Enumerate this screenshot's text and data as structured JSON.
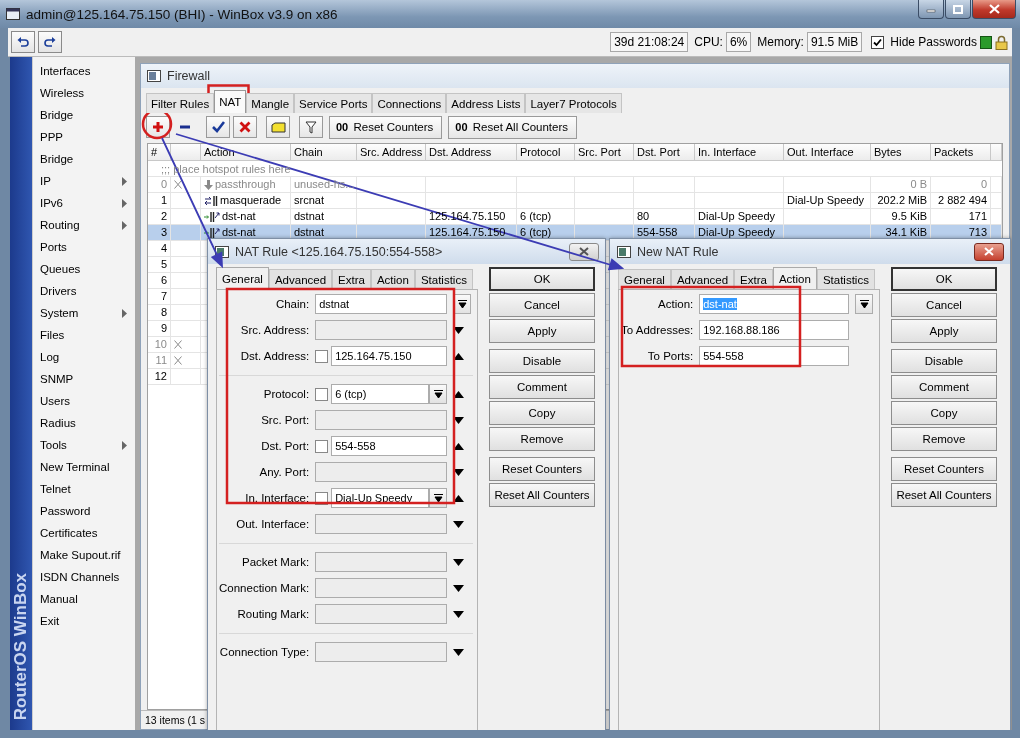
{
  "window": {
    "title": "admin@125.164.75.150 (BHI) - WinBox v3.9 on x86"
  },
  "topbar": {
    "uptime": "39d 21:08:24",
    "cpu_label": "CPU:",
    "cpu": "6%",
    "memory_label": "Memory:",
    "memory": "91.5 MiB",
    "hide_passwords": {
      "label": "Hide Passwords",
      "checked": true
    }
  },
  "side_banner": "RouterOS WinBox",
  "menu": [
    {
      "label": "Interfaces",
      "submenu": false
    },
    {
      "label": "Wireless",
      "submenu": false
    },
    {
      "label": "Bridge",
      "submenu": false
    },
    {
      "label": "PPP",
      "submenu": false
    },
    {
      "label": "Bridge",
      "submenu": false
    },
    {
      "label": "IP",
      "submenu": true
    },
    {
      "label": "IPv6",
      "submenu": true
    },
    {
      "label": "Routing",
      "submenu": true
    },
    {
      "label": "Ports",
      "submenu": false
    },
    {
      "label": "Queues",
      "submenu": false
    },
    {
      "label": "Drivers",
      "submenu": false
    },
    {
      "label": "System",
      "submenu": true
    },
    {
      "label": "Files",
      "submenu": false
    },
    {
      "label": "Log",
      "submenu": false
    },
    {
      "label": "SNMP",
      "submenu": false
    },
    {
      "label": "Users",
      "submenu": false
    },
    {
      "label": "Radius",
      "submenu": false
    },
    {
      "label": "Tools",
      "submenu": true
    },
    {
      "label": "New Terminal",
      "submenu": false
    },
    {
      "label": "Telnet",
      "submenu": false
    },
    {
      "label": "Password",
      "submenu": false
    },
    {
      "label": "Certificates",
      "submenu": false
    },
    {
      "label": "Make Supout.rif",
      "submenu": false
    },
    {
      "label": "ISDN Channels",
      "submenu": false
    },
    {
      "label": "Manual",
      "submenu": false
    },
    {
      "label": "Exit",
      "submenu": false
    }
  ],
  "firewall": {
    "title": "Firewall",
    "tabs": [
      {
        "label": "Filter Rules",
        "selected": false
      },
      {
        "label": "NAT",
        "selected": true
      },
      {
        "label": "Mangle",
        "selected": false
      },
      {
        "label": "Service Ports",
        "selected": false
      },
      {
        "label": "Connections",
        "selected": false
      },
      {
        "label": "Address Lists",
        "selected": false
      },
      {
        "label": "Layer7 Protocols",
        "selected": false
      }
    ],
    "toolbar": [
      {
        "kind": "add"
      },
      {
        "kind": "remove"
      },
      {
        "kind": "enable"
      },
      {
        "kind": "disable"
      },
      {
        "kind": "comment"
      },
      {
        "kind": "filter"
      },
      {
        "kind": "counter",
        "icon_text": "00",
        "label": "Reset Counters"
      },
      {
        "kind": "counter",
        "icon_text": "00",
        "label": "Reset All Counters"
      }
    ],
    "table": {
      "columns": [
        "#",
        "Action",
        "Chain",
        "Src. Address",
        "Dst. Address",
        "Protocol",
        "Src. Port",
        "Dst. Port",
        "In. Interface",
        "Out. Interface",
        "Bytes",
        "Packets"
      ],
      "rows": [
        {
          "kind": "comment",
          "text": ";;; place hotspot rules here"
        },
        {
          "kind": "passthrough",
          "num": "0",
          "disabled": true,
          "selected": false,
          "cells": {
            "action": "passthrough",
            "chain": "unused-hs...",
            "bytes": "0 B",
            "packets": "0"
          }
        },
        {
          "kind": "masquerade",
          "num": "1",
          "disabled": false,
          "selected": false,
          "cells": {
            "action": "masquerade",
            "chain": "srcnat",
            "out_interface": "Dial-Up Speedy",
            "bytes": "202.2 MiB",
            "packets": "2 882 494"
          }
        },
        {
          "kind": "dstnat",
          "num": "2",
          "disabled": false,
          "selected": false,
          "cells": {
            "action": "dst-nat",
            "chain": "dstnat",
            "dst_address": "125.164.75.150",
            "protocol": "6 (tcp)",
            "dst_port": "80",
            "in_interface": "Dial-Up Speedy",
            "bytes": "9.5 KiB",
            "packets": "171"
          }
        },
        {
          "kind": "dstnat",
          "num": "3",
          "disabled": false,
          "selected": true,
          "cells": {
            "action": "dst-nat",
            "chain": "dstnat",
            "dst_address": "125.164.75.150",
            "protocol": "6 (tcp)",
            "dst_port": "554-558",
            "in_interface": "Dial-Up Speedy",
            "bytes": "34.1 KiB",
            "packets": "713"
          }
        },
        {
          "kind": "rule",
          "num": "4",
          "disabled": false,
          "selected": false
        },
        {
          "kind": "rule",
          "num": "5",
          "disabled": false,
          "selected": false
        },
        {
          "kind": "rule",
          "num": "6",
          "disabled": false,
          "selected": false
        },
        {
          "kind": "rule",
          "num": "7",
          "disabled": false,
          "selected": false
        },
        {
          "kind": "rule",
          "num": "8",
          "disabled": false,
          "selected": false
        },
        {
          "kind": "rule",
          "num": "9",
          "disabled": false,
          "selected": false
        },
        {
          "kind": "rule",
          "num": "10",
          "disabled": true,
          "selected": false
        },
        {
          "kind": "rule",
          "num": "11",
          "disabled": true,
          "selected": false
        },
        {
          "kind": "rule",
          "num": "12",
          "disabled": false,
          "selected": false
        }
      ]
    },
    "status": "13 items (1 s"
  },
  "dialogs": [
    {
      "title": "NAT Rule <125.164.75.150:554-558>",
      "active": false,
      "tabs": [
        {
          "label": "General",
          "selected": true
        },
        {
          "label": "Advanced",
          "selected": false
        },
        {
          "label": "Extra",
          "selected": false
        },
        {
          "label": "Action",
          "selected": false
        },
        {
          "label": "Statistics",
          "selected": false
        }
      ],
      "groups": [
        [
          {
            "label": "Chain:",
            "kind": "combo",
            "value": "dstnat"
          },
          {
            "label": "Src. Address:",
            "kind": "text",
            "expanded": false
          },
          {
            "label": "Dst. Address:",
            "kind": "text",
            "negate": false,
            "value": "125.164.75.150",
            "expanded": true
          }
        ],
        [
          {
            "label": "Protocol:",
            "kind": "combo",
            "negate": false,
            "value": "6 (tcp)",
            "expanded": true
          },
          {
            "label": "Src. Port:",
            "kind": "text",
            "expanded": false
          },
          {
            "label": "Dst. Port:",
            "kind": "text",
            "negate": false,
            "value": "554-558",
            "expanded": true
          },
          {
            "label": "Any. Port:",
            "kind": "text",
            "expanded": false
          },
          {
            "label": "In. Interface:",
            "kind": "combo",
            "negate": false,
            "value": "Dial-Up Speedy",
            "expanded": true
          },
          {
            "label": "Out. Interface:",
            "kind": "text",
            "expanded": false
          }
        ],
        [
          {
            "label": "Packet Mark:",
            "kind": "text",
            "expanded": false
          },
          {
            "label": "Connection Mark:",
            "kind": "text",
            "expanded": false
          },
          {
            "label": "Routing Mark:",
            "kind": "text",
            "expanded": false
          }
        ],
        [
          {
            "label": "Connection Type:",
            "kind": "text",
            "expanded": false
          }
        ]
      ],
      "buttons": [
        [
          {
            "label": "OK",
            "default": true
          },
          {
            "label": "Cancel",
            "default": false
          },
          {
            "label": "Apply",
            "default": false
          }
        ],
        [
          {
            "label": "Disable",
            "default": false
          },
          {
            "label": "Comment",
            "default": false
          },
          {
            "label": "Copy",
            "default": false
          },
          {
            "label": "Remove",
            "default": false
          }
        ],
        [
          {
            "label": "Reset Counters",
            "default": false
          },
          {
            "label": "Reset All Counters",
            "default": false
          }
        ]
      ]
    },
    {
      "title": "New NAT Rule",
      "active": true,
      "tabs": [
        {
          "label": "General",
          "selected": false
        },
        {
          "label": "Advanced",
          "selected": false
        },
        {
          "label": "Extra",
          "selected": false
        },
        {
          "label": "Action",
          "selected": true
        },
        {
          "label": "Statistics",
          "selected": false
        }
      ],
      "groups": [
        [
          {
            "label": "Action:",
            "kind": "combo",
            "value": "dst-nat",
            "highlighted": true
          },
          {
            "label": "To Addresses:",
            "kind": "text",
            "value": "192.168.88.186"
          },
          {
            "label": "To Ports:",
            "kind": "text",
            "value": "554-558"
          }
        ]
      ],
      "buttons": [
        [
          {
            "label": "OK",
            "default": true
          },
          {
            "label": "Cancel",
            "default": false
          },
          {
            "label": "Apply",
            "default": false
          }
        ],
        [
          {
            "label": "Disable",
            "default": false
          },
          {
            "label": "Comment",
            "default": false
          },
          {
            "label": "Copy",
            "default": false
          },
          {
            "label": "Remove",
            "default": false
          }
        ],
        [
          {
            "label": "Reset Counters",
            "default": false
          },
          {
            "label": "Reset All Counters",
            "default": false
          }
        ]
      ]
    }
  ]
}
